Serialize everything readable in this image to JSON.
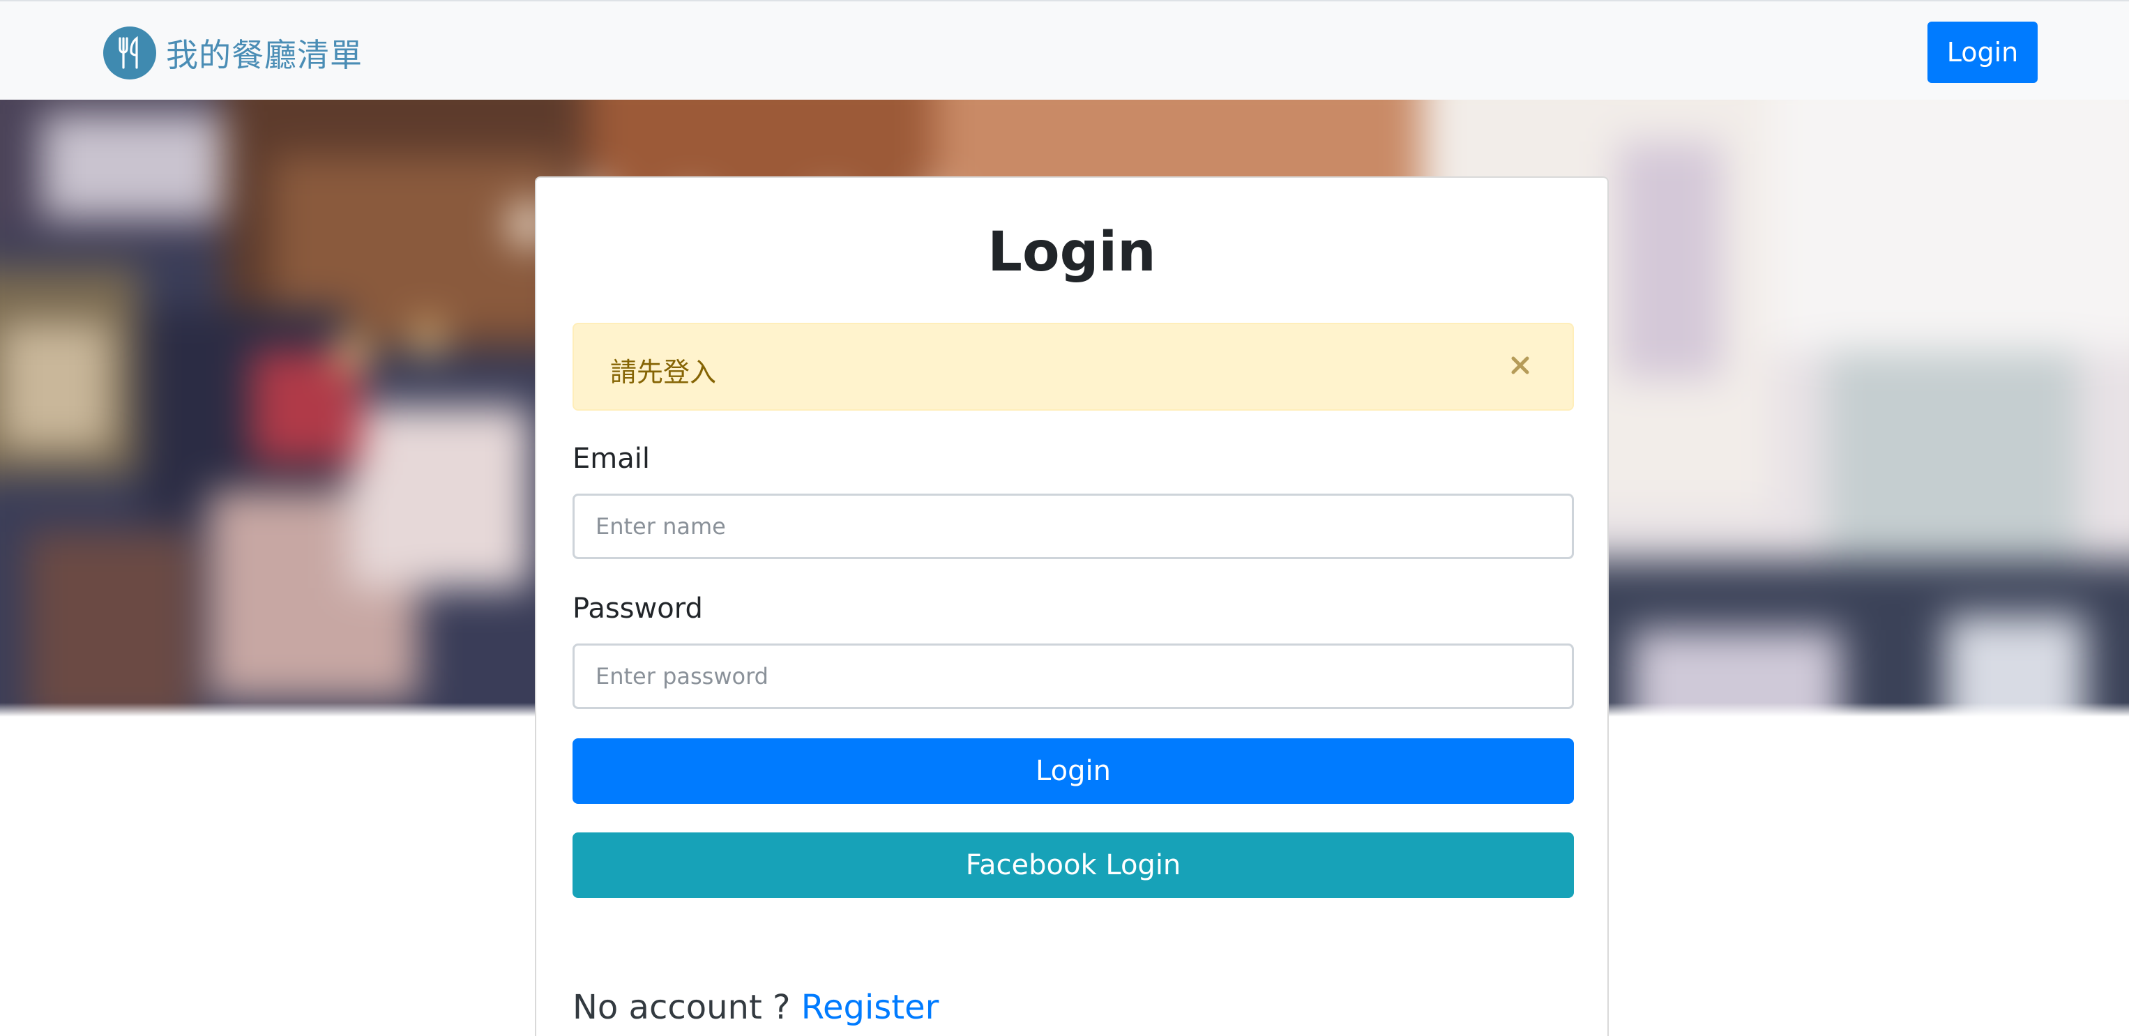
{
  "navbar": {
    "brand_text": "我的餐廳清單",
    "brand_icon": "fork-knife-icon",
    "login_label": "Login"
  },
  "card": {
    "title": "Login",
    "alert": {
      "message": "請先登入",
      "close_icon": "close-icon"
    },
    "email": {
      "label": "Email",
      "placeholder": "Enter name",
      "value": ""
    },
    "password": {
      "label": "Password",
      "placeholder": "Enter password",
      "value": ""
    },
    "login_button": "Login",
    "facebook_button": "Facebook Login",
    "footer": {
      "prompt": "No account ? ",
      "register_link": "Register"
    }
  },
  "colors": {
    "primary": "#007bff",
    "facebook": "#17a2b8",
    "alert_bg": "#fff3cd",
    "alert_text": "#856404",
    "brand": "#4a8db5"
  }
}
